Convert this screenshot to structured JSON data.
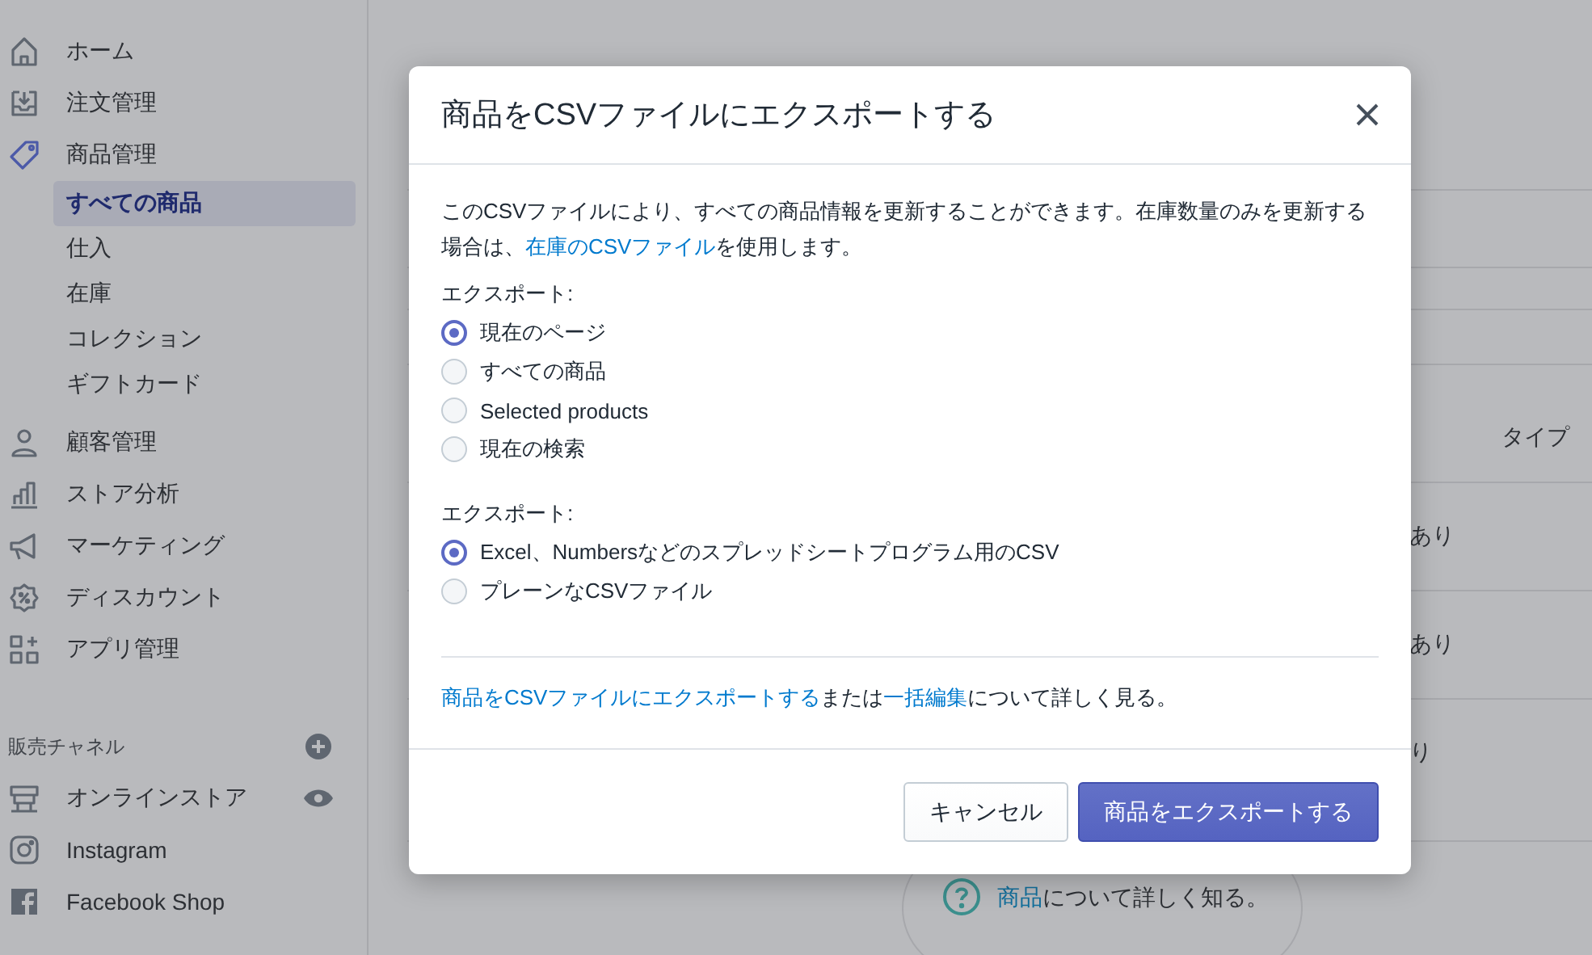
{
  "sidebar": {
    "nav": [
      {
        "label": "ホーム",
        "selected": false
      },
      {
        "label": "注文管理",
        "selected": false
      },
      {
        "label": "商品管理",
        "selected": true,
        "children": [
          {
            "label": "すべての商品",
            "selected": true
          },
          {
            "label": "仕入",
            "selected": false
          },
          {
            "label": "在庫",
            "selected": false
          },
          {
            "label": "コレクション",
            "selected": false
          },
          {
            "label": "ギフトカード",
            "selected": false
          }
        ]
      },
      {
        "label": "顧客管理",
        "selected": false
      },
      {
        "label": "ストア分析",
        "selected": false
      },
      {
        "label": "マーケティング",
        "selected": false
      },
      {
        "label": "ディスカウント",
        "selected": false
      },
      {
        "label": "アプリ管理",
        "selected": false
      }
    ],
    "channels_heading": "販売チャネル",
    "channels": [
      {
        "label": "オンラインストア"
      },
      {
        "label": "Instagram"
      },
      {
        "label": "Facebook Shop"
      }
    ]
  },
  "main": {
    "table": {
      "header": "タイプ",
      "rows": [
        {
          "column_1": "あり"
        },
        {
          "column_1": "あり"
        },
        {
          "column_1": "り"
        }
      ]
    },
    "help": {
      "link": "商品",
      "text": "について詳しく知る。"
    }
  },
  "modal": {
    "title": "商品をCSVファイルにエクスポートする",
    "description": [
      {
        "kind": "text",
        "text": "このCSVファイルにより、すべての商品情報を更新することができます。在庫数量のみを更新する場合は、"
      },
      {
        "kind": "link",
        "text": "在庫のCSVファイル"
      },
      {
        "kind": "text",
        "text": "を使用します。"
      }
    ],
    "groups": [
      {
        "label": "エクスポート:",
        "options": [
          {
            "label": "現在のページ",
            "selected": true
          },
          {
            "label": "すべての商品",
            "selected": false
          },
          {
            "label": "Selected products",
            "selected": false
          },
          {
            "label": "現在の検索",
            "selected": false
          }
        ]
      },
      {
        "label": "エクスポート:",
        "options": [
          {
            "label": "Excel、Numbersなどのスプレッドシートプログラム用のCSV",
            "selected": true
          },
          {
            "label": "プレーンなCSVファイル",
            "selected": false
          }
        ]
      }
    ],
    "note": [
      {
        "kind": "link",
        "text": "商品をCSVファイルにエクスポートする"
      },
      {
        "kind": "text",
        "text": "または"
      },
      {
        "kind": "link",
        "text": "一括編集"
      },
      {
        "kind": "text",
        "text": "について詳しく見る。"
      }
    ],
    "buttons": [
      {
        "label": "キャンセル",
        "kind": "secondary"
      },
      {
        "label": "商品をエクスポートする",
        "kind": "primary"
      }
    ]
  }
}
